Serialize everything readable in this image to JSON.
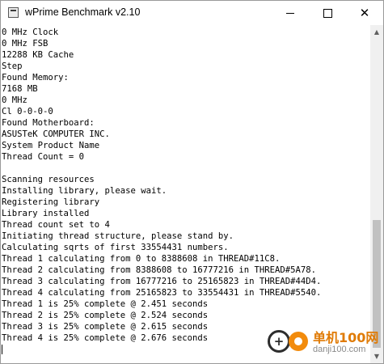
{
  "window": {
    "title": "wPrime Benchmark v2.10",
    "icon": "app-console-icon"
  },
  "console": {
    "lines": [
      "0 MHz Clock",
      "0 MHz FSB",
      "12288 KB Cache",
      "Step",
      "Found Memory:",
      "7168 MB",
      "0 MHz",
      "Cl 0-0-0-0",
      "Found Motherboard:",
      "ASUSTeK COMPUTER INC.",
      "System Product Name",
      "Thread Count = 0",
      "",
      "Scanning resources",
      "Installing library, please wait.",
      "Registering library",
      "Library installed",
      "Thread count set to 4",
      "Initiating thread structure, please stand by.",
      "Calculating sqrts of first 33554431 numbers.",
      "Thread 1 calculating from 0 to 8388608 in THREAD#11C8.",
      "Thread 2 calculating from 8388608 to 16777216 in THREAD#5A78.",
      "Thread 3 calculating from 16777216 to 25165823 in THREAD#44D4.",
      "Thread 4 calculating from 25165823 to 33554431 in THREAD#5540.",
      "Thread 1 is 25% complete @ 2.451 seconds",
      "Thread 2 is 25% complete @ 2.524 seconds",
      "Thread 3 is 25% complete @ 2.615 seconds",
      "Thread 4 is 25% complete @ 2.676 seconds"
    ]
  },
  "scrollbar": {
    "position_fraction": 0.6,
    "thumb_fraction": 0.4
  },
  "watermark": {
    "brand_cn": "单机100网",
    "url": "danji100.com",
    "colors": {
      "orange": "#f28b0c",
      "dark": "#2d2d2d"
    }
  }
}
